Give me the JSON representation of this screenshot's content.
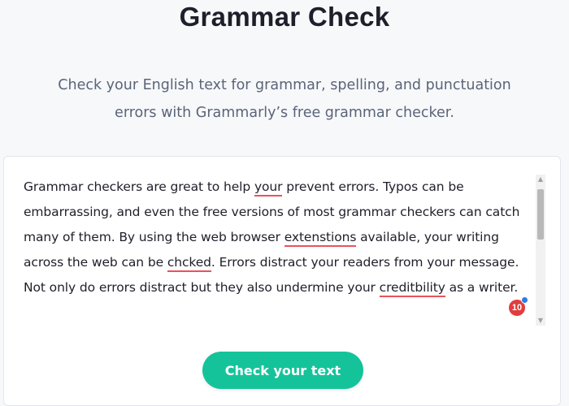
{
  "header": {
    "title": "Grammar Check",
    "subtitle_line1": "Check your English text for grammar, spelling, and punctuation",
    "subtitle_line2": "errors with Grammarly’s free grammar checker."
  },
  "editor": {
    "segments": [
      {
        "text": "Grammar checkers are great to help "
      },
      {
        "text": "your",
        "error": true
      },
      {
        "text": " prevent errors. Typos can be embarrassing, and even the free versions of most grammar checkers can catch many of them. By using the web browser "
      },
      {
        "text": "extenstions",
        "error": true
      },
      {
        "text": " available, your writing across the web can be "
      },
      {
        "text": "chcked",
        "error": true
      },
      {
        "text": ". Errors distract your readers from your message. Not only do errors distract but they also undermine your "
      },
      {
        "text": "creditbility",
        "error": true
      },
      {
        "text": " as a writer."
      }
    ],
    "error_count": "10",
    "error_color": "#e8535b"
  },
  "actions": {
    "check_label": "Check your text",
    "accent": "#15c39a"
  },
  "colors": {
    "badge": "#e23d3d",
    "badge_dot": "#2f7be5"
  }
}
